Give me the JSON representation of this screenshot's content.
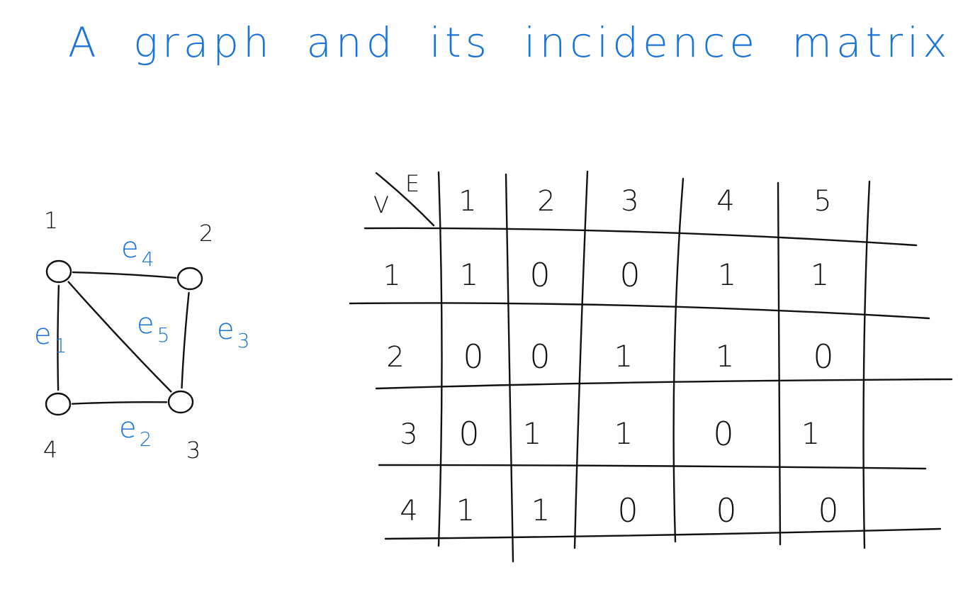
{
  "title": "A graph and its incidence matrix",
  "colors": {
    "blue_ink": "#1a73d9",
    "black_ink": "#111111",
    "background": "#ffffff"
  },
  "graph": {
    "vertices": [
      {
        "id": "1",
        "label": "1"
      },
      {
        "id": "2",
        "label": "2"
      },
      {
        "id": "3",
        "label": "3"
      },
      {
        "id": "4",
        "label": "4"
      }
    ],
    "edges": [
      {
        "id": "e1",
        "label_base": "e",
        "label_sub": "1",
        "from": "1",
        "to": "4"
      },
      {
        "id": "e2",
        "label_base": "e",
        "label_sub": "2",
        "from": "4",
        "to": "3"
      },
      {
        "id": "e3",
        "label_base": "e",
        "label_sub": "3",
        "from": "2",
        "to": "3"
      },
      {
        "id": "e4",
        "label_base": "e",
        "label_sub": "4",
        "from": "1",
        "to": "2"
      },
      {
        "id": "e5",
        "label_base": "e",
        "label_sub": "5",
        "from": "1",
        "to": "3"
      }
    ]
  },
  "matrix": {
    "corner_row_header": "V",
    "corner_col_header": "E",
    "col_labels": [
      "1",
      "2",
      "3",
      "4",
      "5"
    ],
    "row_labels": [
      "1",
      "2",
      "3",
      "4"
    ],
    "cells": [
      [
        "1",
        "0",
        "0",
        "1",
        "1"
      ],
      [
        "0",
        "0",
        "1",
        "1",
        "0"
      ],
      [
        "0",
        "1",
        "1",
        "0",
        "1"
      ],
      [
        "1",
        "1",
        "0",
        "0",
        "0"
      ]
    ]
  }
}
